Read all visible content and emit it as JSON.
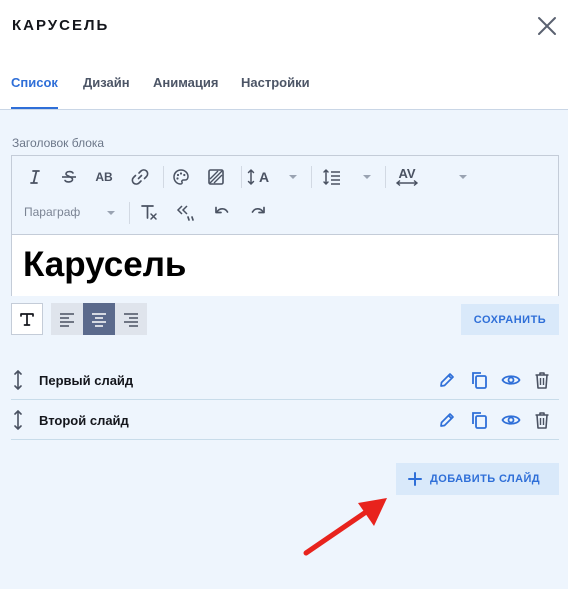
{
  "header": {
    "title": "КАРУСЕЛЬ"
  },
  "tabs": [
    {
      "label": "Список",
      "active": true
    },
    {
      "label": "Дизайн",
      "active": false
    },
    {
      "label": "Анимация",
      "active": false
    },
    {
      "label": "Настройки",
      "active": false
    }
  ],
  "block_title": {
    "label": "Заголовок блока",
    "paragraph_style": "Параграф",
    "value": "Карусель",
    "toolbar_text_buttons": {
      "case": "AB",
      "font_size": "A",
      "spacing": "AV"
    }
  },
  "format": {
    "save_label": "СОХРАНИТЬ",
    "active_alignment": "center"
  },
  "slides": [
    {
      "name": "Первый слайд"
    },
    {
      "name": "Второй слайд"
    }
  ],
  "add_slide": {
    "label": "ДОБАВИТЬ СЛАЙД"
  },
  "colors": {
    "accent": "#2f6fd8",
    "panel_bg": "#eef5fd",
    "annotation_arrow": "#e8231d",
    "active_align_bg": "#5b6a8c"
  }
}
